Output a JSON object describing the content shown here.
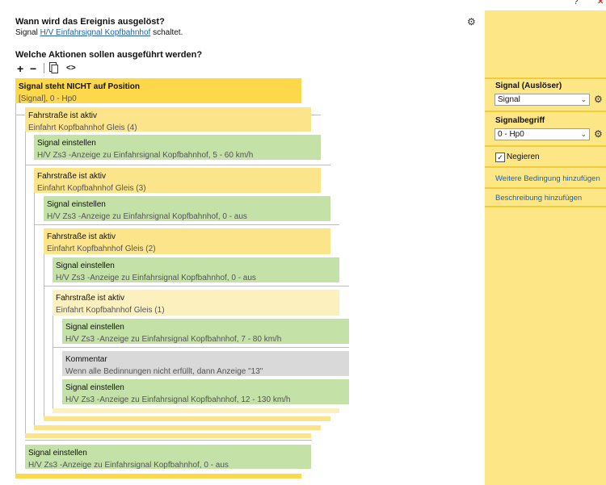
{
  "window": {
    "help": "?",
    "close": "✕"
  },
  "trigger": {
    "question": "Wann wird das Ereignis ausgelöst?",
    "prefix": "Signal ",
    "link": "H/V Einfahrsignal Kopfbahnhof",
    "suffix": " schaltet."
  },
  "actions": {
    "question": "Welche Aktionen sollen ausgeführt werden?",
    "toolbar": {
      "add": "+",
      "remove": "−",
      "copy_icon": "copy-icon",
      "code": "<>"
    }
  },
  "blocks": [
    {
      "title": "Signal steht NICHT auf Position",
      "sub": "[Signal], 0 - Hp0"
    },
    {
      "title": "Fahrstraße ist aktiv",
      "sub": "Einfahrt Kopfbahnhof Gleis (4)"
    },
    {
      "title": "Signal einstellen",
      "sub": "H/V Zs3 -Anzeige zu Einfahrsignal Kopfbahnhof, 5 - 60 km/h"
    },
    {
      "title": "Fahrstraße ist aktiv",
      "sub": "Einfahrt Kopfbahnhof Gleis (3)"
    },
    {
      "title": "Signal einstellen",
      "sub": "H/V Zs3 -Anzeige zu Einfahrsignal Kopfbahnhof, 0 - aus"
    },
    {
      "title": "Fahrstraße ist aktiv",
      "sub": "Einfahrt Kopfbahnhof Gleis (2)"
    },
    {
      "title": "Signal einstellen",
      "sub": "H/V Zs3 -Anzeige zu Einfahrsignal Kopfbahnhof, 0 - aus"
    },
    {
      "title": "Fahrstraße ist aktiv",
      "sub": "Einfahrt Kopfbahnhof Gleis (1)"
    },
    {
      "title": "Signal einstellen",
      "sub": "H/V Zs3 -Anzeige zu Einfahrsignal Kopfbahnhof, 7 - 80 km/h"
    },
    {
      "title": "Kommentar",
      "sub": "Wenn alle Bedinnungen nicht erfüllt, dann Anzeige \"13\""
    },
    {
      "title": "Signal einstellen",
      "sub": "H/V Zs3 -Anzeige zu Einfahrsignal Kopfbahnhof, 12 - 130 km/h"
    },
    {
      "title": "Signal einstellen",
      "sub": "H/V Zs3 -Anzeige zu Einfahrsignal Kopfbahnhof, 0 - aus"
    }
  ],
  "panel": {
    "signal_label": "Signal (Auslöser)",
    "signal_value": "Signal",
    "aspect_label": "Signalbegriff",
    "aspect_value": "0 - Hp0",
    "negate_label": "Negieren",
    "negate_checked": true,
    "add_condition": "Weitere Bedingung hinzufügen",
    "add_description": "Beschreibung hinzufügen"
  }
}
